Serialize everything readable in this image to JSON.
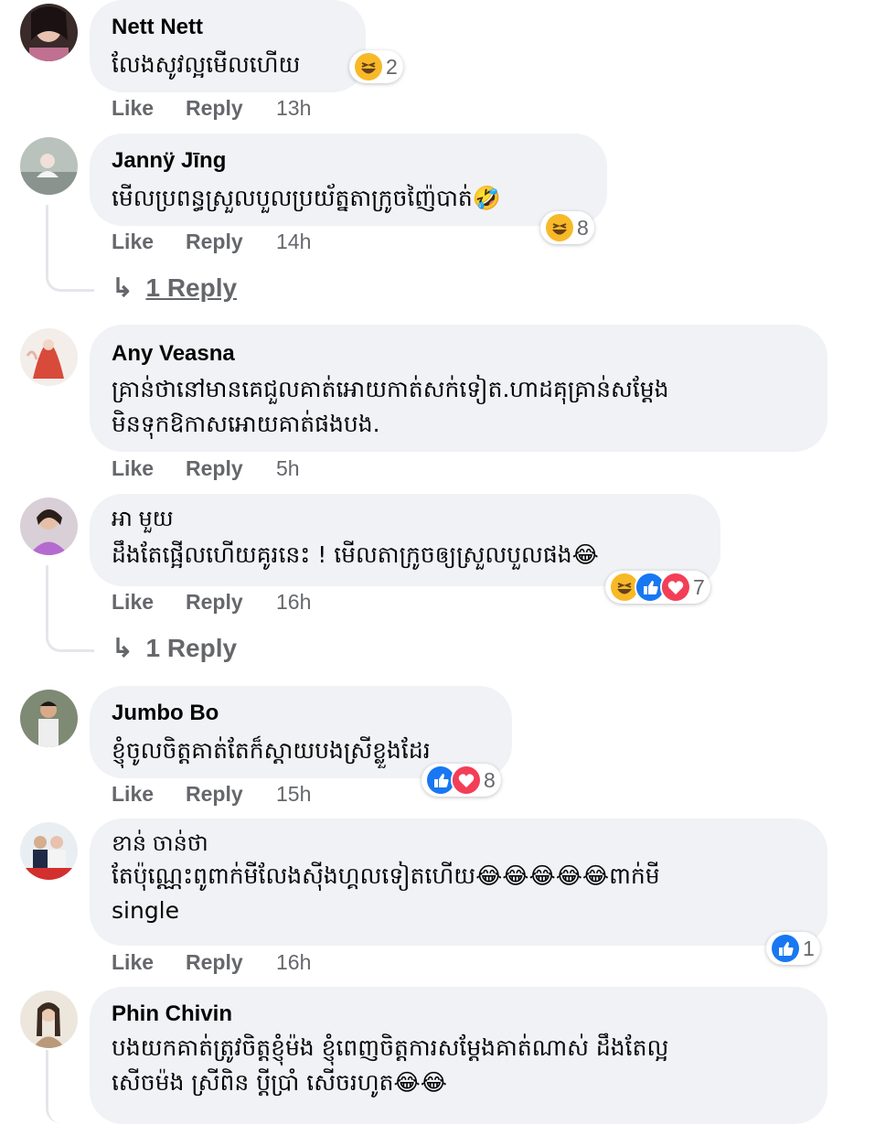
{
  "actions": {
    "like": "Like",
    "reply": "Reply"
  },
  "comments": [
    {
      "name": "Nett Nett",
      "lines": [
        "លែងសូវល្អមើលហើយ"
      ],
      "time": "13h",
      "reactions": [
        "haha"
      ],
      "reaction_count": "2"
    },
    {
      "name": "Jannÿ Jīng",
      "lines": [
        "មើលប្រពន្ធស្រួលបួលប្រយ័ត្នតាក្រូចញ៉ៃបាត់🤣"
      ],
      "time": "14h",
      "reactions": [
        "haha"
      ],
      "reaction_count": "8",
      "replies": "1 Reply"
    },
    {
      "name": "Any Veasna",
      "lines": [
        "គ្រាន់ថានៅមានគេជួលគាត់អោយកាត់សក់ទៀត.ហាដគុគ្រាន់សម្ដែង",
        "មិនទុកឱកាសអោយគាត់ផងបង."
      ],
      "time": "5h"
    },
    {
      "name": "អា មួយ",
      "lines": [
        "ដឹងតែផ្អើលហើយគូរនេះ ! មើលតាក្រូចឲ្យស្រួលបួលផង😂"
      ],
      "time": "16h",
      "reactions": [
        "haha",
        "like",
        "love"
      ],
      "reaction_count": "7",
      "replies": "1 Reply"
    },
    {
      "name": "Jumbo Bo",
      "lines": [
        "ខ្ញុំចូលចិត្តគាត់តែក៏ស្តាយបងស្រីខ្លួងដែរ"
      ],
      "time": "15h",
      "reactions": [
        "like",
        "love"
      ],
      "reaction_count": "8"
    },
    {
      "name": "ខាន់ ចាន់ថា",
      "lines": [
        "តែប៉ុណ្ណេះពូពាក់មីលែងស៊ីងហ្គលទៀតហើយ😂😂😂😂😂ពាក់មី",
        "single"
      ],
      "time": "16h",
      "reactions": [
        "like"
      ],
      "reaction_count": "1"
    },
    {
      "name": "Phin Chivin",
      "lines": [
        "បងយកគាត់ត្រូវចិត្តខ្ញុំម៉ង ខ្ញុំពេញចិត្តការសម្ដែងគាត់ណាស់ ដឹងតែល្អ",
        "សើចម៉ង ស្រីពិន ប្ដីប្រាំ សើចរហូត😂😂"
      ]
    }
  ],
  "colors": {
    "bubble": "#f0f2f5",
    "secondary_text": "#65676b",
    "like_blue": "#1877f2",
    "love_red": "#f33e58",
    "haha_yellow": "#f7b928"
  }
}
